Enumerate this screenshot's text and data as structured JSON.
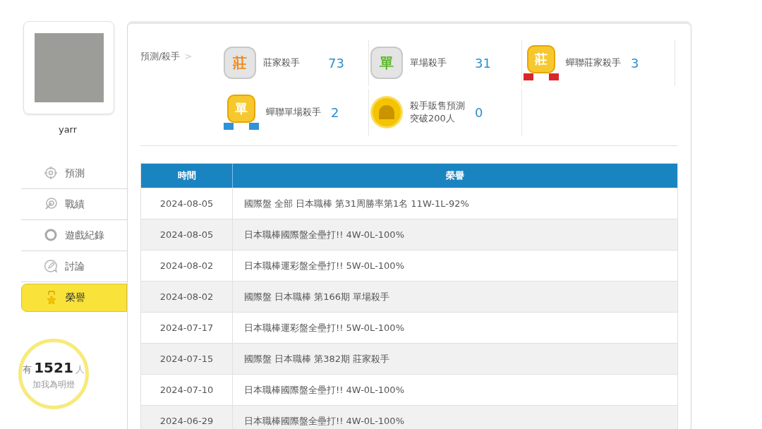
{
  "profile": {
    "name": "yarr"
  },
  "menu": [
    {
      "label": "預測",
      "kind": "target",
      "selected": false
    },
    {
      "label": "戰績",
      "kind": "record",
      "selected": false
    },
    {
      "label": "遊戲紀錄",
      "kind": "ring",
      "selected": false
    },
    {
      "label": "討論",
      "kind": "chat",
      "selected": false
    },
    {
      "label": "榮譽",
      "kind": "star",
      "selected": true
    }
  ],
  "fans": {
    "prefix": "有",
    "count": "1521",
    "suffix": "人",
    "caption": "加我為明燈"
  },
  "breadcrumb": "預測/殺手",
  "breadcrumb_arrow": ">",
  "badges": [
    {
      "kind": "silver",
      "icon_text": "莊",
      "color": "#f08a1c",
      "label": "莊家殺手",
      "count": "73"
    },
    {
      "kind": "silver",
      "icon_text": "單",
      "color": "#5cb82e",
      "label": "單場殺手",
      "count": "31"
    },
    {
      "kind": "ribbon",
      "icon_text": "莊",
      "color": "#d9262b",
      "label": "蟬聯莊家殺手",
      "count": "3"
    },
    {
      "kind": "ribbon",
      "icon_text": "單",
      "color": "#2f93d8",
      "label": "蟬聯單場殺手",
      "count": "2"
    },
    {
      "kind": "coin",
      "label": "殺手販售預測突破200人",
      "count": "0"
    }
  ],
  "table": {
    "columns": [
      "時間",
      "榮譽"
    ],
    "rows": [
      [
        "2024-08-05",
        "國際盤 全部 日本職棒 第31周勝率第1名 11W-1L-92%"
      ],
      [
        "2024-08-05",
        "日本職棒國際盤全壘打!! 4W-0L-100%"
      ],
      [
        "2024-08-02",
        "日本職棒運彩盤全壘打!! 5W-0L-100%"
      ],
      [
        "2024-08-02",
        "國際盤 日本職棒 第166期 單場殺手"
      ],
      [
        "2024-07-17",
        "日本職棒運彩盤全壘打!! 5W-0L-100%"
      ],
      [
        "2024-07-15",
        "國際盤 日本職棒 第382期 莊家殺手"
      ],
      [
        "2024-07-10",
        "日本職棒國際盤全壘打!! 4W-0L-100%"
      ],
      [
        "2024-06-29",
        "日本職棒國際盤全壘打!! 4W-0L-100%"
      ]
    ]
  }
}
